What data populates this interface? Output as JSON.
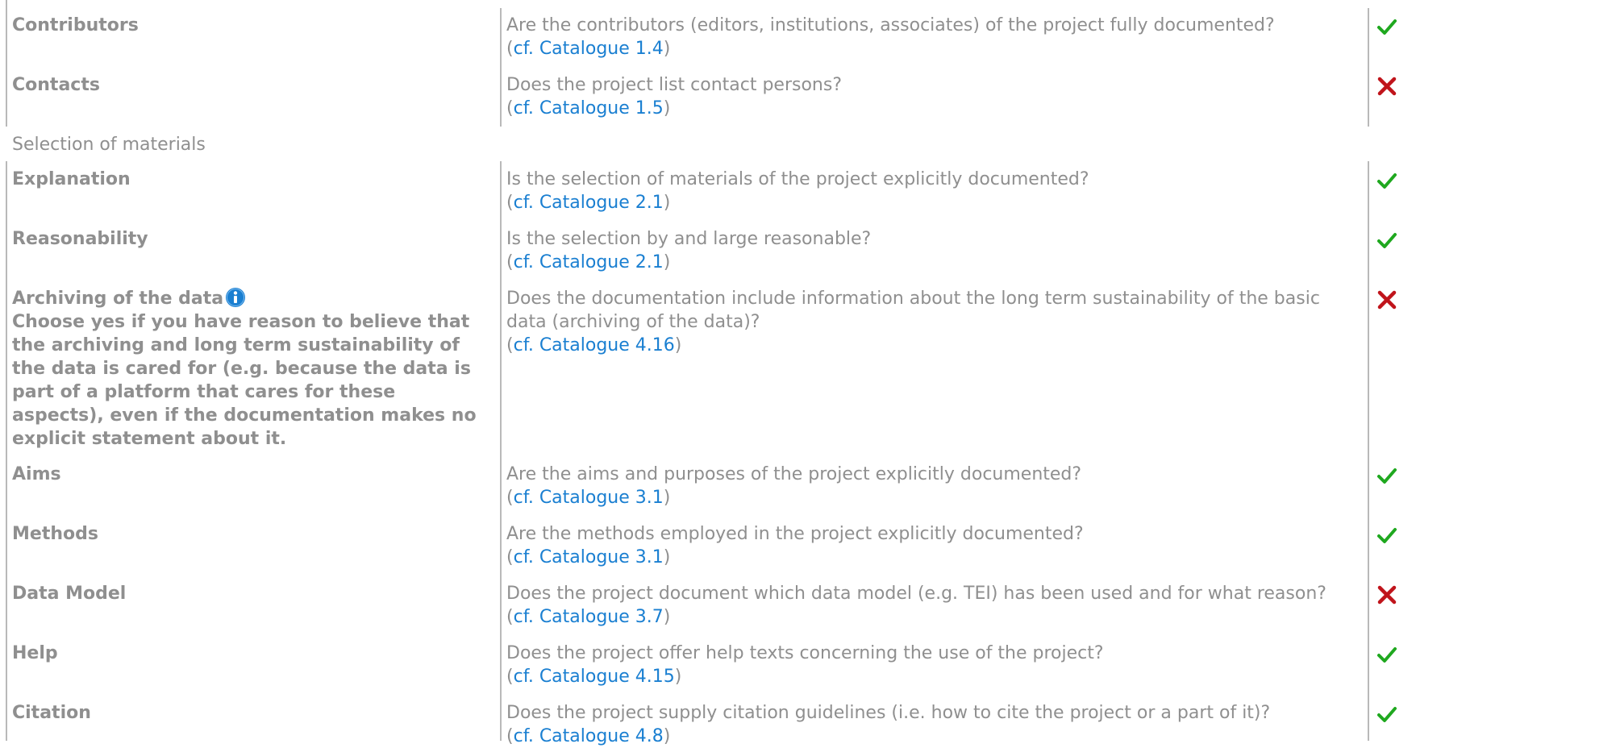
{
  "link_prefix": "(",
  "link_suffix": ")",
  "rows_top": [
    {
      "label": "Contributors",
      "question": "Are the contributors (editors, institutions, associates) of the project fully documented?",
      "link": "cf. Catalogue 1.4",
      "status": "yes"
    },
    {
      "label": "Contacts",
      "question": "Does the project list contact persons?",
      "link": "cf. Catalogue 1.5",
      "status": "no"
    }
  ],
  "section_title": "Selection of materials",
  "rows_bottom": [
    {
      "label": "Explanation",
      "question": "Is the selection of materials of the project explicitly documented?",
      "link": "cf. Catalogue 2.1",
      "status": "yes"
    },
    {
      "label": "Reasonability",
      "question": "Is the selection by and large reasonable?",
      "link": "cf. Catalogue 2.1",
      "status": "yes"
    },
    {
      "label": "Archiving of the data",
      "note": "Choose yes if you have reason to believe that the archiving and long term sustainability of the data is cared for (e.g. because the data is part of a platform that cares for these aspects), even if the documentation makes no explicit statement about it.",
      "question": "Does the documentation include information about the long term sustainability of the basic data (archiving of the data)?",
      "link": "cf. Catalogue 4.16",
      "status": "no",
      "icon": "info-icon"
    },
    {
      "label": "Aims",
      "question": "Are the aims and purposes of the project explicitly documented?",
      "link": "cf. Catalogue 3.1",
      "status": "yes"
    },
    {
      "label": "Methods",
      "question": "Are the methods employed in the project explicitly documented?",
      "link": "cf. Catalogue 3.1",
      "status": "yes"
    },
    {
      "label": "Data Model",
      "question": "Does the project document which data model (e.g. TEI) has been used and for what reason?",
      "link": "cf. Catalogue 3.7",
      "status": "no"
    },
    {
      "label": "Help",
      "question": "Does the project offer help texts concerning the use of the project?",
      "link": "cf. Catalogue 4.15",
      "status": "yes"
    },
    {
      "label": "Citation",
      "question": "Does the project supply citation guidelines (i.e. how to cite the project or a part of it)?",
      "link": "cf. Catalogue 4.8",
      "status": "yes"
    }
  ],
  "colors": {
    "text": "#8f8f8f",
    "link": "#1a7fd1",
    "check": "#1fa81f",
    "cross": "#c0141b",
    "divider": "#b9b9b9",
    "info_icon": "#1a7fd1"
  }
}
